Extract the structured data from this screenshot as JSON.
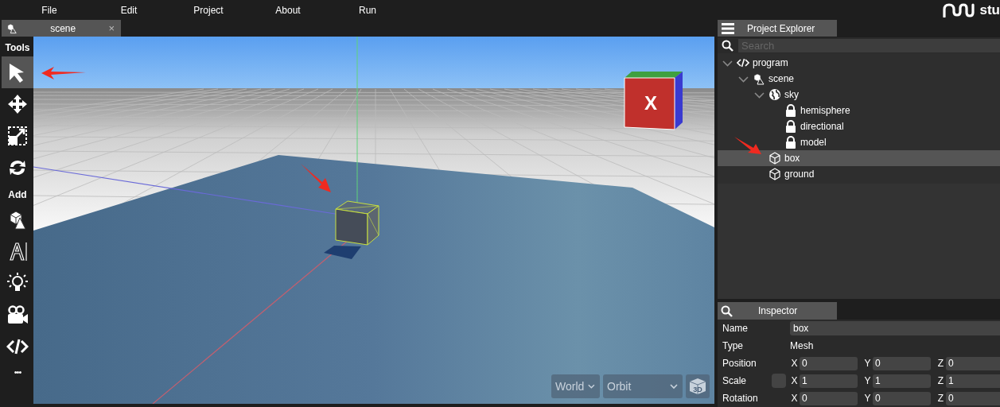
{
  "menu": [
    {
      "label": "File"
    },
    {
      "label": "Edit"
    },
    {
      "label": "Project"
    },
    {
      "label": "About"
    },
    {
      "label": "Run"
    }
  ],
  "logo": {
    "text": "stu"
  },
  "editor_tab": {
    "label": "scene",
    "close": "×",
    "selected": true
  },
  "toolbar": [
    {
      "label": "Tools",
      "items": [
        {
          "kind": "pointer",
          "selected": true
        },
        {
          "kind": "move",
          "selected": false
        },
        {
          "kind": "scale",
          "selected": false
        },
        {
          "kind": "rotate",
          "selected": false
        }
      ]
    },
    {
      "label": "Add",
      "items": [
        {
          "kind": "shapes",
          "selected": false
        },
        {
          "kind": "text",
          "selected": false
        },
        {
          "kind": "light",
          "selected": false
        },
        {
          "kind": "camera",
          "selected": false
        },
        {
          "kind": "code",
          "selected": false
        }
      ]
    }
  ],
  "toolbar_more": "•••",
  "viewport": {
    "view_cube_label": "X",
    "space": "World",
    "mode": "Orbit",
    "view_button": "3D"
  },
  "project_explorer": {
    "title": "Project Explorer",
    "search": {
      "placeholder": "Search"
    },
    "tree": [
      {
        "label": "program",
        "kind": "code",
        "expanded": true,
        "selected": false,
        "children": [
          {
            "label": "scene",
            "kind": "scene",
            "expanded": true,
            "selected": false,
            "children": [
              {
                "label": "sky",
                "kind": "globe",
                "expanded": true,
                "selected": false,
                "children": [
                  {
                    "label": "hemisphere",
                    "kind": "lock",
                    "selected": false
                  },
                  {
                    "label": "directional",
                    "kind": "lock",
                    "selected": false
                  },
                  {
                    "label": "model",
                    "kind": "lock",
                    "selected": false
                  }
                ]
              },
              {
                "label": "box",
                "kind": "cube",
                "selected": true
              },
              {
                "label": "ground",
                "kind": "cube",
                "selected": false
              }
            ]
          }
        ]
      }
    ]
  },
  "inspector": {
    "title": "Inspector",
    "rows": [
      {
        "kind": "field",
        "label": "Name",
        "value": "box"
      },
      {
        "kind": "text",
        "label": "Type",
        "value": "Mesh"
      },
      {
        "kind": "vector",
        "label": "Position",
        "axes": [
          {
            "axis": "X",
            "value": "0"
          },
          {
            "axis": "Y",
            "value": "0"
          },
          {
            "axis": "Z",
            "value": "0"
          }
        ]
      },
      {
        "kind": "vector",
        "label": "Scale",
        "lock": {
          "checked": false
        },
        "axes": [
          {
            "axis": "X",
            "value": "1"
          },
          {
            "axis": "Y",
            "value": "1"
          },
          {
            "axis": "Z",
            "value": "1"
          }
        ]
      },
      {
        "kind": "vector",
        "label": "Rotation",
        "axes": [
          {
            "axis": "X",
            "value": "0"
          },
          {
            "axis": "Y",
            "value": "0"
          },
          {
            "axis": "Z",
            "value": "0"
          }
        ]
      }
    ]
  }
}
